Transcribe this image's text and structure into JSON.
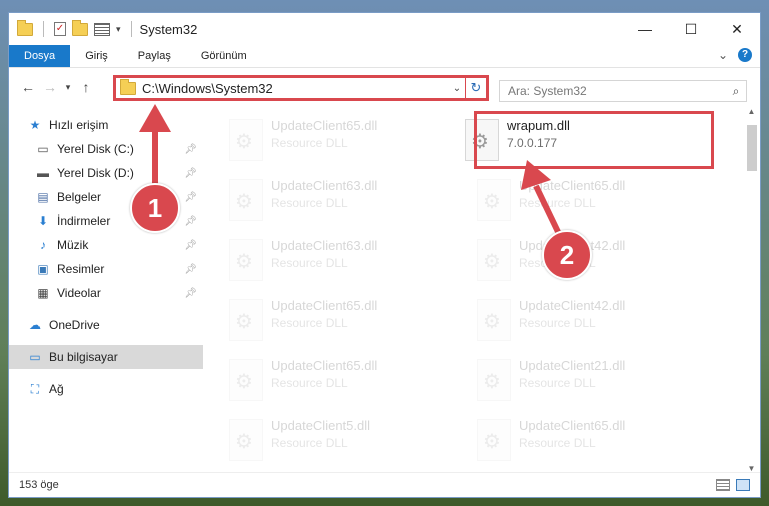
{
  "window": {
    "title": "System32",
    "minimize_glyph": "—",
    "maximize_glyph": "☐",
    "close_glyph": "✕"
  },
  "ribbon": {
    "tabs": [
      "Dosya",
      "Giriş",
      "Paylaş",
      "Görünüm"
    ],
    "expand_glyph": "⌄",
    "help_glyph": "?"
  },
  "address": {
    "path": "C:\\Windows\\System32",
    "search_placeholder": "Ara: System32"
  },
  "sidebar": {
    "items": [
      {
        "label": "Hızlı erişim",
        "icon": "star-icon",
        "glyph": "★"
      },
      {
        "label": "Yerel Disk (C:)",
        "icon": "drive-icon",
        "glyph": "▭"
      },
      {
        "label": "Yerel Disk (D:)",
        "icon": "drive-icon",
        "glyph": "▬"
      },
      {
        "label": "Belgeler",
        "icon": "documents-icon",
        "glyph": "▤"
      },
      {
        "label": "İndirmeler",
        "icon": "download-icon",
        "glyph": "⬇"
      },
      {
        "label": "Müzik",
        "icon": "music-icon",
        "glyph": "♪"
      },
      {
        "label": "Resimler",
        "icon": "pictures-icon",
        "glyph": "▣"
      },
      {
        "label": "Videolar",
        "icon": "video-icon",
        "glyph": "▦"
      },
      {
        "label": "OneDrive",
        "icon": "cloud-icon",
        "glyph": "☁"
      },
      {
        "label": "Bu bilgisayar",
        "icon": "computer-icon",
        "glyph": "▭"
      },
      {
        "label": "Ağ",
        "icon": "network-icon",
        "glyph": "⛶"
      }
    ]
  },
  "files": {
    "highlighted": {
      "name": "wrapum.dll",
      "detail": "7.0.0.177"
    },
    "faded": [
      {
        "name": "UpdateClient65.dll",
        "detail": "Resource DLL"
      },
      {
        "name": "UpdateClient63.dll",
        "detail": "Resource DLL"
      },
      {
        "name": "UpdateClient65.dll",
        "detail": "Resource DLL"
      },
      {
        "name": "UpdateClient63.dll",
        "detail": "Resource DLL"
      },
      {
        "name": "UpdateClient42.dll",
        "detail": "Resource DLL"
      },
      {
        "name": "UpdateClient65.dll",
        "detail": "Resource DLL"
      },
      {
        "name": "UpdateClient42.dll",
        "detail": "Resource DLL"
      },
      {
        "name": "UpdateClient65.dll",
        "detail": "Resource DLL"
      },
      {
        "name": "UpdateClient21.dll",
        "detail": "Resource DLL"
      },
      {
        "name": "UpdateClient5.dll",
        "detail": "Resource DLL"
      },
      {
        "name": "UpdateClient65.dll",
        "detail": "Resource DLL"
      }
    ]
  },
  "status": {
    "count": "153 öge"
  },
  "callouts": {
    "one": "1",
    "two": "2"
  },
  "colors": {
    "accent": "#1979ca",
    "highlight_red": "#d9484e"
  }
}
